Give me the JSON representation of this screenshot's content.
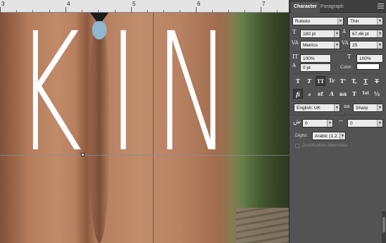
{
  "ruler": {
    "numbers": [
      "3",
      "4",
      "5",
      "6",
      "7"
    ]
  },
  "headline": {
    "letters": [
      "K",
      "I",
      "N"
    ]
  },
  "panel": {
    "tabs": [
      "Character",
      "Paragraph"
    ],
    "font_family": "Roboto",
    "font_style": "Thin",
    "font_size": "180 pt",
    "leading": "67,46 pt",
    "kerning": "Metrics",
    "tracking": "25",
    "vertical_scale": "100%",
    "horizontal_scale": "100%",
    "baseline_shift": "0 pt",
    "color_label": "Color:",
    "color_value": "#ffffff",
    "style_buttons": [
      "T",
      "T",
      "TT",
      "Tr",
      "T'",
      "T,",
      "T",
      "T"
    ],
    "opentype_buttons": [
      "fi",
      "ℴ",
      "st",
      "A",
      "aa",
      "T",
      "1st",
      "½"
    ],
    "language": "English: UK",
    "antialias": "Sharp",
    "field_a_value": "0",
    "field_b_value": "0",
    "digits_label": "Digits:",
    "digits_value": "Arabic (1,2...",
    "justification_alternates": "Justification Alternates"
  }
}
